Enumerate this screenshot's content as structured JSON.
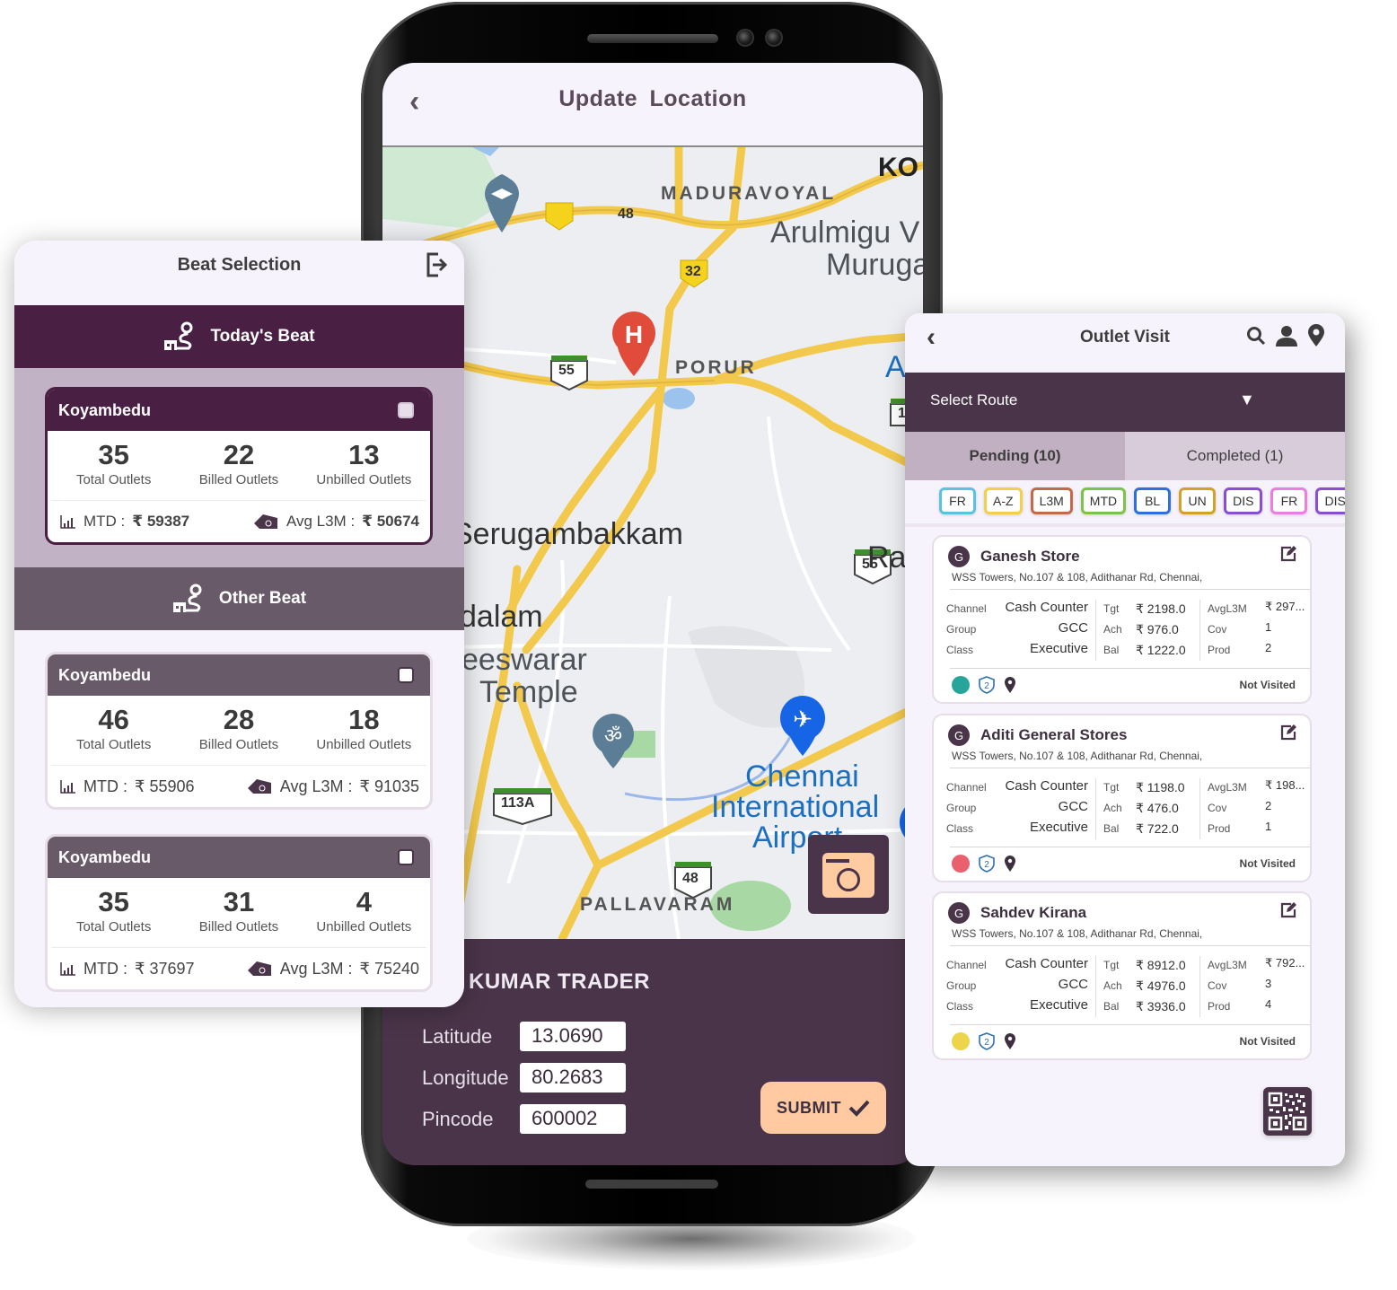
{
  "update_location": {
    "title": "Update  Location",
    "back_icon": "chevron-left",
    "map": {
      "labels": {
        "maduravoyal": "MADURAVOYAL",
        "ko": "KO",
        "arulmigu": "Arulmigu V",
        "muruga": "Muruga",
        "porur": "PORUR",
        "a": "A",
        "serugambakkam": "Serugambakkam",
        "ra": "Ra",
        "dalam": "dalam",
        "eeswarar": "eeswarar",
        "temple": "Temple",
        "airport_1": "Chennai",
        "airport_2": "International",
        "airport_3": "Airport",
        "pallavaram": "PALLAVARAM"
      },
      "shields": {
        "nh48_top": "48",
        "sh32": "32",
        "nh55_left": "55",
        "nh55_right": "55",
        "nh113a": "113A",
        "nh48_bottom": "48",
        "nh1_partial": "1"
      }
    },
    "camera_icon": "camera",
    "store_name": "KUMAR TRADER",
    "fields": [
      {
        "label": "Latitude",
        "value": "13.0690"
      },
      {
        "label": "Longitude",
        "value": "80.2683"
      },
      {
        "label": "Pincode",
        "value": "600002"
      }
    ],
    "submit_label": "SUBMIT"
  },
  "beat_selection": {
    "title": "Beat Selection",
    "logout_icon": "logout",
    "todays_beat_label": "Today's Beat",
    "other_beat_label": "Other Beat",
    "total_label": "Total Outlets",
    "billed_label": "Billed Outlets",
    "unbilled_label": "Unbilled Outlets",
    "mtd_label": "MTD :",
    "avg_label": "Avg L3M :",
    "currency": "₹",
    "today": {
      "name": "Koyambedu",
      "total": "35",
      "billed": "22",
      "unbilled": "13",
      "mtd": "₹ 59387",
      "avg_l3m": "₹ 50674"
    },
    "others": [
      {
        "name": "Koyambedu",
        "total": "46",
        "billed": "28",
        "unbilled": "18",
        "mtd": "₹ 55906",
        "avg_l3m": "₹ 91035"
      },
      {
        "name": "Koyambedu",
        "total": "35",
        "billed": "31",
        "unbilled": "4",
        "mtd": "₹ 37697",
        "avg_l3m": "₹ 75240"
      }
    ]
  },
  "outlet_visit": {
    "title": "Outlet Visit",
    "select_route": "Select Route",
    "tabs": {
      "pending": "Pending (10)",
      "completed": "Completed (1)"
    },
    "chips": [
      {
        "label": "FR",
        "color": "#5bc3dd"
      },
      {
        "label": "A-Z",
        "color": "#f1d04a"
      },
      {
        "label": "L3M",
        "color": "#c26a4a"
      },
      {
        "label": "MTD",
        "color": "#7dc24a"
      },
      {
        "label": "BL",
        "color": "#2f6fe0"
      },
      {
        "label": "UN",
        "color": "#d1a22a"
      },
      {
        "label": "DIS",
        "color": "#8a4fd0"
      },
      {
        "label": "FR",
        "color": "#ea7fe0"
      },
      {
        "label": "DIS",
        "color": "#8a4fd0"
      }
    ],
    "labels": {
      "channel": "Channel",
      "group": "Group",
      "class": "Class",
      "tgt": "Tgt",
      "ach": "Ach",
      "bal": "Bal",
      "avgl3m": "AvgL3M",
      "cov": "Cov",
      "prod": "Prod"
    },
    "outlets": [
      {
        "initial": "G",
        "name": "Ganesh Store",
        "address": "WSS Towers, No.107 & 108, Adithanar Rd, Chennai,",
        "channel": "Cash Counter",
        "group": "GCC",
        "class": "Executive",
        "tgt": "₹ 2198.0",
        "ach": "₹ 976.0",
        "bal": "₹ 1222.0",
        "avgl3m": "₹ 297...",
        "cov": "1",
        "prod": "2",
        "status_color": "#26a69a",
        "badge": "2",
        "status": "Not Visited"
      },
      {
        "initial": "G",
        "name": "Aditi General Stores",
        "address": "WSS Towers, No.107 & 108, Adithanar Rd, Chennai,",
        "channel": "Cash Counter",
        "group": "GCC",
        "class": "Executive",
        "tgt": "₹ 1198.0",
        "ach": "₹ 476.0",
        "bal": "₹ 722.0",
        "avgl3m": "₹ 198...",
        "cov": "2",
        "prod": "1",
        "status_color": "#e9606e",
        "badge": "2",
        "status": "Not Visited"
      },
      {
        "initial": "G",
        "name": "Sahdev Kirana",
        "address": "WSS Towers, No.107 & 108, Adithanar Rd, Chennai,",
        "channel": "Cash Counter",
        "group": "GCC",
        "class": "Executive",
        "tgt": "₹ 8912.0",
        "ach": "₹ 4976.0",
        "bal": "₹ 3936.0",
        "avgl3m": "₹ 792...",
        "cov": "3",
        "prod": "4",
        "status_color": "#ecd54a",
        "badge": "2",
        "status": "Not Visited"
      }
    ]
  }
}
